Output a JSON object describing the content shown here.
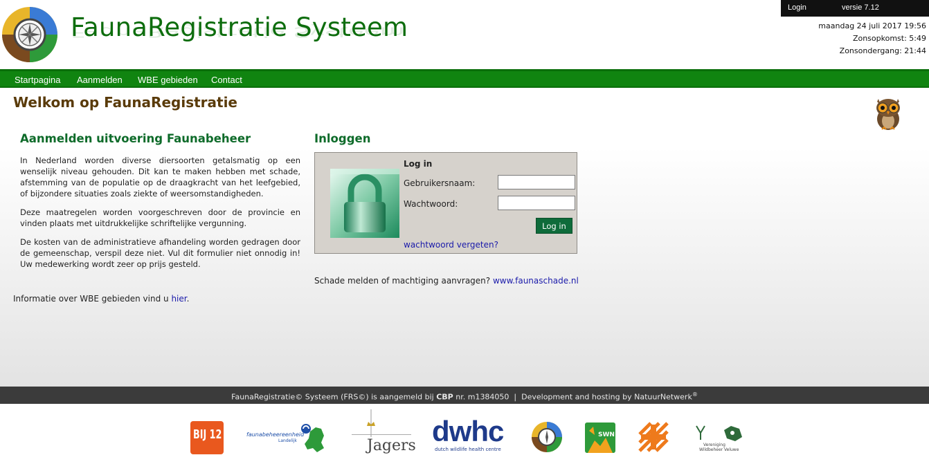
{
  "header": {
    "title": "FaunaRegistratie Systeem",
    "topbar": {
      "login_label": "Login",
      "version": "versie 7.12"
    },
    "date": "maandag 24 juli 2017 19:56",
    "sunrise": "Zonsopkomst: 5:49",
    "sunset": "Zonsondergang: 21:44"
  },
  "nav": {
    "items": [
      {
        "label": "Startpagina"
      },
      {
        "label": "Aanmelden"
      },
      {
        "label": "WBE gebieden"
      },
      {
        "label": "Contact"
      }
    ]
  },
  "main": {
    "welcome": "Welkom op FaunaRegistratie",
    "left": {
      "heading": "Aanmelden uitvoering Faunabeheer",
      "paragraphs": [
        "In Nederland worden diverse diersoorten getalsmatig op een wenselijk niveau gehouden. Dit kan te maken hebben met schade, afstemming van de populatie op de draagkracht van het leefgebied, of bijzondere situaties zoals ziekte of weersomstandigheden.",
        "Deze maatregelen worden voorgeschreven door de provincie en vinden plaats met uitdrukkelijke schriftelijke vergunning.",
        "De kosten van de administratieve afhandeling worden gedragen door de gemeenschap, verspil deze niet. Vul dit formulier niet onnodig in! Uw medewerking wordt zeer op prijs gesteld."
      ],
      "wbe_info_prefix": "Informatie over WBE gebieden vind u ",
      "wbe_info_link": "hier",
      "wbe_info_suffix": "."
    },
    "right": {
      "heading": "Inloggen",
      "box_title": "Log in",
      "username_label": "Gebruikersnaam:",
      "password_label": "Wachtwoord:",
      "username_value": "",
      "password_value": "",
      "login_button": "Log in",
      "forgot_link": "wachtwoord vergeten?",
      "schade_prefix": "Schade melden of machtiging aanvragen? ",
      "schade_link": "www.faunaschade.nl"
    }
  },
  "footer": {
    "text_prefix": "FaunaRegistratie© Systeem (FRS©) is aangemeld bij ",
    "cbp": "CBP",
    "text_mid": " nr. m1384050  |  Development and hosting by NatuurNetwerk",
    "reg": "®"
  },
  "partners": {
    "bij12": "BIJ 12",
    "faunabeheer_line1": "faunabeheereenheid",
    "faunabeheer_line2": "Landelijk",
    "jagers": "Jagers",
    "dwhc": "dwhc",
    "dwhc_sub": "dutch wildlife health centre",
    "swn": "SWN",
    "veluwe_line1": "Vereniging",
    "veluwe_line2": "Wildbeheer Veluwe"
  },
  "colors": {
    "brand_green": "#0d6d0d",
    "nav_green": "#108410",
    "heading_green": "#0e6b2a",
    "welcome_brown": "#5a3b0a",
    "login_button": "#0e6b3a",
    "footer_bar": "#3b3b3b"
  }
}
